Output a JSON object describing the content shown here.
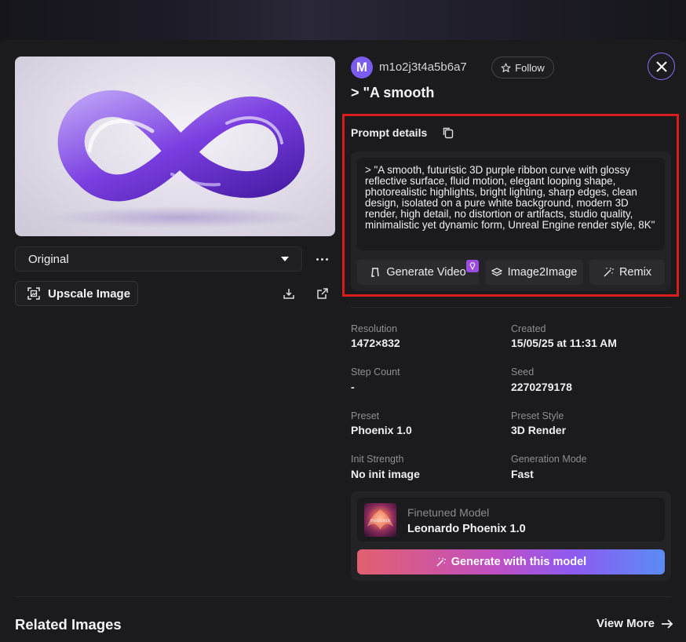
{
  "user": {
    "avatar_initial": "M",
    "username": "m1o2j3t4a5b6a7",
    "follow_label": "Follow"
  },
  "title": "> \"A smooth",
  "image_select": {
    "selected": "Original"
  },
  "upscale_label": "Upscale Image",
  "prompt": {
    "label": "Prompt details",
    "text": "> \"A smooth, futuristic 3D purple ribbon curve with glossy reflective surface, fluid motion, elegant looping shape, photorealistic highlights, bright lighting, sharp edges, clean design, isolated on a pure white background, modern 3D render, high detail, no distortion or artifacts, studio quality, minimalistic yet dynamic form, Unreal Engine render style, 8K\"",
    "actions": {
      "generate_video": "Generate Video",
      "image2image": "Image2Image",
      "remix": "Remix"
    }
  },
  "meta": {
    "resolution_label": "Resolution",
    "resolution": "1472×832",
    "created_label": "Created",
    "created": "15/05/25 at 11:31 AM",
    "step_count_label": "Step Count",
    "step_count": "-",
    "seed_label": "Seed",
    "seed": "2270279178",
    "preset_label": "Preset",
    "preset": "Phoenix 1.0",
    "preset_style_label": "Preset Style",
    "preset_style": "3D Render",
    "init_strength_label": "Init Strength",
    "init_strength": "No init image",
    "generation_mode_label": "Generation Mode",
    "generation_mode": "Fast"
  },
  "model": {
    "sub_label": "Finetuned Model",
    "name": "Leonardo Phoenix 1.0",
    "thumb_text": "PHOENIX",
    "generate_label": "Generate with this model"
  },
  "related": {
    "title": "Related Images",
    "view_more": "View More"
  },
  "colors": {
    "accent_purple": "#7b5cf0",
    "highlight_red": "#d91c1c",
    "gem": "#9a4ce0"
  }
}
